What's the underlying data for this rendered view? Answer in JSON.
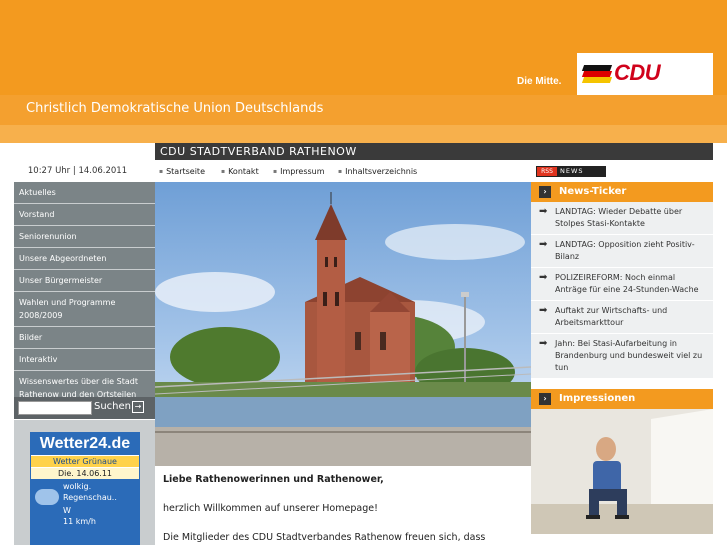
{
  "header": {
    "slogan": "Die Mitte.",
    "logo_text": "CDU",
    "party_name": "Christlich Demokratische Union Deutschlands",
    "title": "CDU STADTVERBAND RATHENOW"
  },
  "datetime": "10:27 Uhr | 14.06.2011",
  "topnav": [
    "Startseite",
    "Kontakt",
    "Impressum",
    "Inhaltsverzeichnis"
  ],
  "rss": {
    "tag": "RSS",
    "label": "NEWS"
  },
  "leftnav": [
    "Aktuelles",
    "Vorstand",
    "Seniorenunion",
    "Unsere Abgeordneten",
    "Unser Bürgermeister",
    "Wahlen und Programme 2008/2009",
    "Bilder",
    "Interaktiv",
    "Wissenswertes über die Stadt Rathenow und den Ortsteilen"
  ],
  "search": {
    "label": "Suchen",
    "value": ""
  },
  "weather": {
    "logo": "Wetter24.de",
    "location": "Wetter Grünaue",
    "date": "Die. 14.06.11",
    "desc_line1": "wolkig.",
    "desc_line2": "Regenschau..",
    "wind_dir": "W",
    "wind_speed": "11 km/h"
  },
  "content": {
    "greeting": "Liebe Rathenowerinnen und Rathenower,",
    "welcome": "herzlich Willkommen auf unserer Homepage!",
    "intro": "Die Mitglieder des CDU Stadtverbandes Rathenow freuen sich, dass"
  },
  "news": {
    "title": "News-Ticker",
    "items": [
      "LANDTAG: Wieder Debatte über Stolpes Stasi-Kontakte",
      "LANDTAG: Opposition zieht Positiv-Bilanz",
      "POLIZEIREFORM: Noch einmal Anträge für eine 24-Stunden-Wache",
      "Auftakt zur Wirtschafts- und Arbeitsmarkttour",
      "Jahn: Bei Stasi-Aufarbeitung in Brandenburg und bundesweit viel zu tun"
    ]
  },
  "impressionen": {
    "title": "Impressionen"
  },
  "colors": {
    "orange": "#f39a1f",
    "nav_gray": "#7b8487",
    "dark": "#3a3a3a",
    "cdu_red": "#d0021b"
  }
}
